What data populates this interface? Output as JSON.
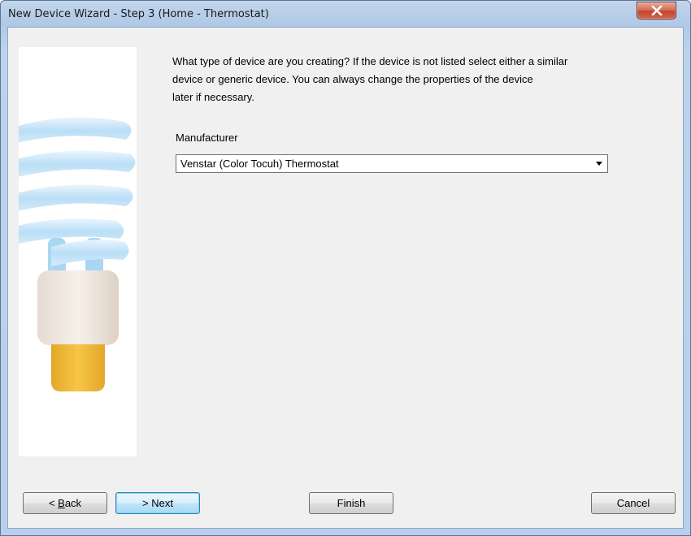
{
  "window": {
    "title": "New Device Wizard - Step 3 (Home - Thermostat)"
  },
  "icons": {
    "close": "close-icon",
    "side_image": "lightbulb-illustration"
  },
  "content": {
    "intro_lines": [
      "What type of device are you creating?  If the device is not listed select either a similar",
      "device or generic device.  You can always change the properties of the device",
      "later if necessary."
    ],
    "manufacturer_label": "Manufacturer",
    "manufacturer_value": "Venstar (Color Tocuh) Thermostat"
  },
  "buttons": {
    "back_prefix": "< ",
    "back_mnemonic": "B",
    "back_rest": "ack",
    "next": "> Next",
    "finish": "Finish",
    "cancel": "Cancel"
  },
  "colors": {
    "close_button": "#c5452a",
    "default_button_border": "#3c7fb1",
    "dialog_background": "#f0f0f0"
  }
}
